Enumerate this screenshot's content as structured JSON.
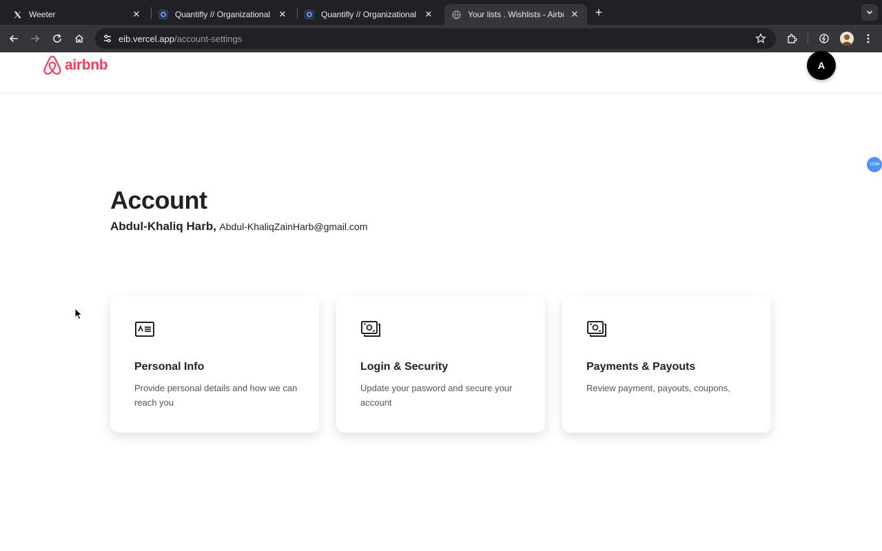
{
  "browser": {
    "tabs": [
      {
        "title": "Weeter",
        "active": false
      },
      {
        "title": "Quantifly // Organizational Dia",
        "active": false
      },
      {
        "title": "Quantifly // Organizational Dia",
        "active": false
      },
      {
        "title": "Your lists . Wishlists - Airbnb",
        "active": true
      }
    ],
    "url_host": "eib.vercel.app",
    "url_path": "/account-settings"
  },
  "header": {
    "logo_text": "airbnb",
    "avatar_initial": "A",
    "brand_color": "#ff385c"
  },
  "extension_badge": "123M",
  "account": {
    "title": "Account",
    "name": "Abdul-Khaliq Harb,",
    "email": "Abdul-KhaliqZainHarb@gmail.com"
  },
  "cards": [
    {
      "title": "Personal Info",
      "description": "Provide personal details and how we can reach you",
      "icon": "id-card-icon"
    },
    {
      "title": "Login & Security",
      "description": "Update your pasword and secure your account",
      "icon": "cash-icon"
    },
    {
      "title": "Payments & Payouts",
      "description": "Review payment, payouts, coupons,",
      "icon": "cash-icon"
    }
  ]
}
